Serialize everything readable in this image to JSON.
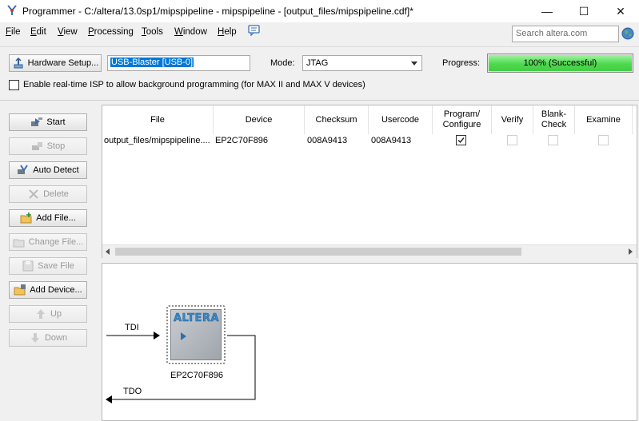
{
  "window": {
    "title": "Programmer - C:/altera/13.0sp1/mipspipeline - mipspipeline - [output_files/mipspipeline.cdf]*",
    "minimize": "—",
    "maximize": "☐",
    "close": "✕"
  },
  "menu": {
    "items": [
      {
        "first": "F",
        "rest": "ile"
      },
      {
        "first": "E",
        "rest": "dit"
      },
      {
        "first": "V",
        "rest": "iew"
      },
      {
        "first": "P",
        "rest": "rocessing"
      },
      {
        "first": "T",
        "rest": "ools"
      },
      {
        "first": "W",
        "rest": "indow"
      },
      {
        "first": "H",
        "rest": "elp"
      }
    ],
    "search_placeholder": "Search altera.com"
  },
  "toolbar": {
    "hardware_setup_label": "Hardware Setup...",
    "hardware_value": "USB-Blaster [USB-0]",
    "mode_label": "Mode:",
    "mode_value": "JTAG",
    "progress_label": "Progress:",
    "progress_text": "100% (Successful)",
    "progress_fraction": 1.0,
    "progress_color": "#4fd84f",
    "isp_label": "Enable real-time ISP to allow background programming (for MAX II and MAX V devices)",
    "isp_checked": false
  },
  "side_buttons": [
    {
      "label": "Start",
      "enabled": true,
      "icon": "start-icon"
    },
    {
      "label": "Stop",
      "enabled": false,
      "icon": "stop-icon"
    },
    {
      "label": "Auto Detect",
      "enabled": true,
      "icon": "auto-detect-icon"
    },
    {
      "label": "Delete",
      "enabled": false,
      "icon": "delete-icon"
    },
    {
      "label": "Add File...",
      "enabled": true,
      "icon": "add-file-icon"
    },
    {
      "label": "Change File...",
      "enabled": false,
      "icon": "change-file-icon"
    },
    {
      "label": "Save File",
      "enabled": false,
      "icon": "save-file-icon"
    },
    {
      "label": "Add Device...",
      "enabled": true,
      "icon": "add-device-icon"
    },
    {
      "label": "Up",
      "enabled": false,
      "icon": "up-arrow-icon"
    },
    {
      "label": "Down",
      "enabled": false,
      "icon": "down-arrow-icon"
    }
  ],
  "table": {
    "headers": {
      "file": "File",
      "device": "Device",
      "checksum": "Checksum",
      "usercode": "Usercode",
      "program": "Program/ Configure",
      "verify": "Verify",
      "blank_check": "Blank- Check",
      "examine": "Examine"
    },
    "rows": [
      {
        "file": "output_files/mipspipeline....",
        "device": "EP2C70F896",
        "checksum": "008A9413",
        "usercode": "008A9413",
        "program": true,
        "verify": false,
        "blank_check": false,
        "examine": false
      }
    ]
  },
  "chain": {
    "tdi_label": "TDI",
    "tdo_label": "TDO",
    "device_name": "EP2C70F896",
    "chip_logo": "ALTERA"
  }
}
